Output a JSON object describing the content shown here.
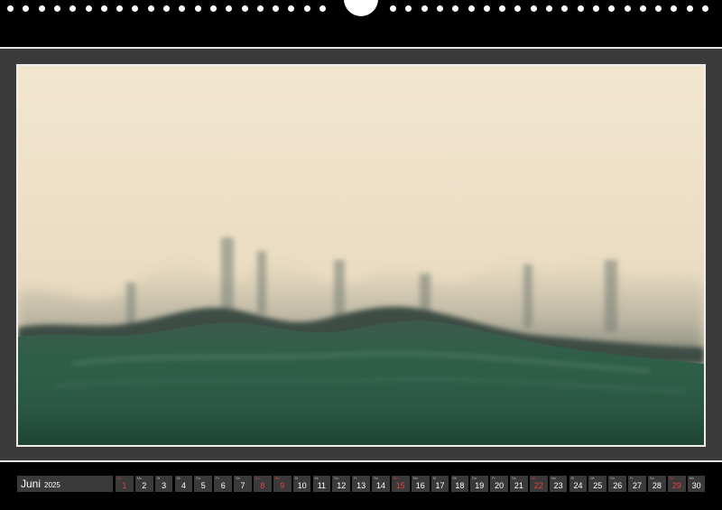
{
  "calendar": {
    "month": "Juni",
    "year": "2025",
    "days": [
      {
        "day": "1",
        "weekday": "So",
        "weekend": true
      },
      {
        "day": "2",
        "weekday": "Mo",
        "weekend": false
      },
      {
        "day": "3",
        "weekday": "Di",
        "weekend": false
      },
      {
        "day": "4",
        "weekday": "Mi",
        "weekend": false
      },
      {
        "day": "5",
        "weekday": "Do",
        "weekend": false
      },
      {
        "day": "6",
        "weekday": "Fr",
        "weekend": false
      },
      {
        "day": "7",
        "weekday": "Sa",
        "weekend": false
      },
      {
        "day": "8",
        "weekday": "So",
        "weekend": true
      },
      {
        "day": "9",
        "weekday": "Mo",
        "weekend": true
      },
      {
        "day": "10",
        "weekday": "Di",
        "weekend": false
      },
      {
        "day": "11",
        "weekday": "Mi",
        "weekend": false
      },
      {
        "day": "12",
        "weekday": "Do",
        "weekend": false
      },
      {
        "day": "13",
        "weekday": "Fr",
        "weekend": false
      },
      {
        "day": "14",
        "weekday": "Sa",
        "weekend": false
      },
      {
        "day": "15",
        "weekday": "So",
        "weekend": true
      },
      {
        "day": "16",
        "weekday": "Mo",
        "weekend": false
      },
      {
        "day": "17",
        "weekday": "Di",
        "weekend": false
      },
      {
        "day": "18",
        "weekday": "Mi",
        "weekend": false
      },
      {
        "day": "19",
        "weekday": "Do",
        "weekend": false
      },
      {
        "day": "20",
        "weekday": "Fr",
        "weekend": false
      },
      {
        "day": "21",
        "weekday": "Sa",
        "weekend": false
      },
      {
        "day": "22",
        "weekday": "So",
        "weekend": true
      },
      {
        "day": "23",
        "weekday": "Mo",
        "weekend": false
      },
      {
        "day": "24",
        "weekday": "Di",
        "weekend": false
      },
      {
        "day": "25",
        "weekday": "Mi",
        "weekend": false
      },
      {
        "day": "26",
        "weekday": "Do",
        "weekend": false
      },
      {
        "day": "27",
        "weekday": "Fr",
        "weekend": false
      },
      {
        "day": "28",
        "weekday": "Sa",
        "weekend": false
      },
      {
        "day": "29",
        "weekday": "So",
        "weekend": true
      },
      {
        "day": "30",
        "weekday": "Mo",
        "weekend": false
      }
    ]
  },
  "colors": {
    "page_background": "#3a3a3a",
    "weekend_red": "#e84040",
    "sky": "#f1e2c8",
    "sea": "#2e5a45"
  }
}
